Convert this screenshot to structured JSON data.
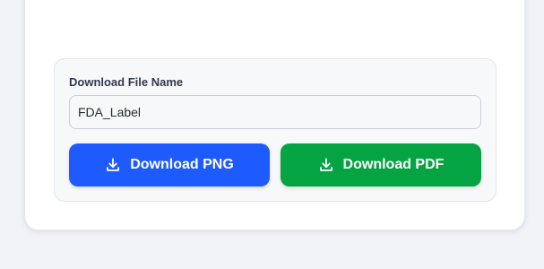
{
  "download_panel": {
    "label": "Download File Name",
    "file_name_value": "FDA_Label",
    "buttons": {
      "png_label": "Download PNG",
      "pdf_label": "Download PDF"
    },
    "icons": {
      "png": "download-icon",
      "pdf": "download-icon"
    },
    "colors": {
      "png_button": "#1e5bff",
      "pdf_button": "#04a443"
    }
  }
}
